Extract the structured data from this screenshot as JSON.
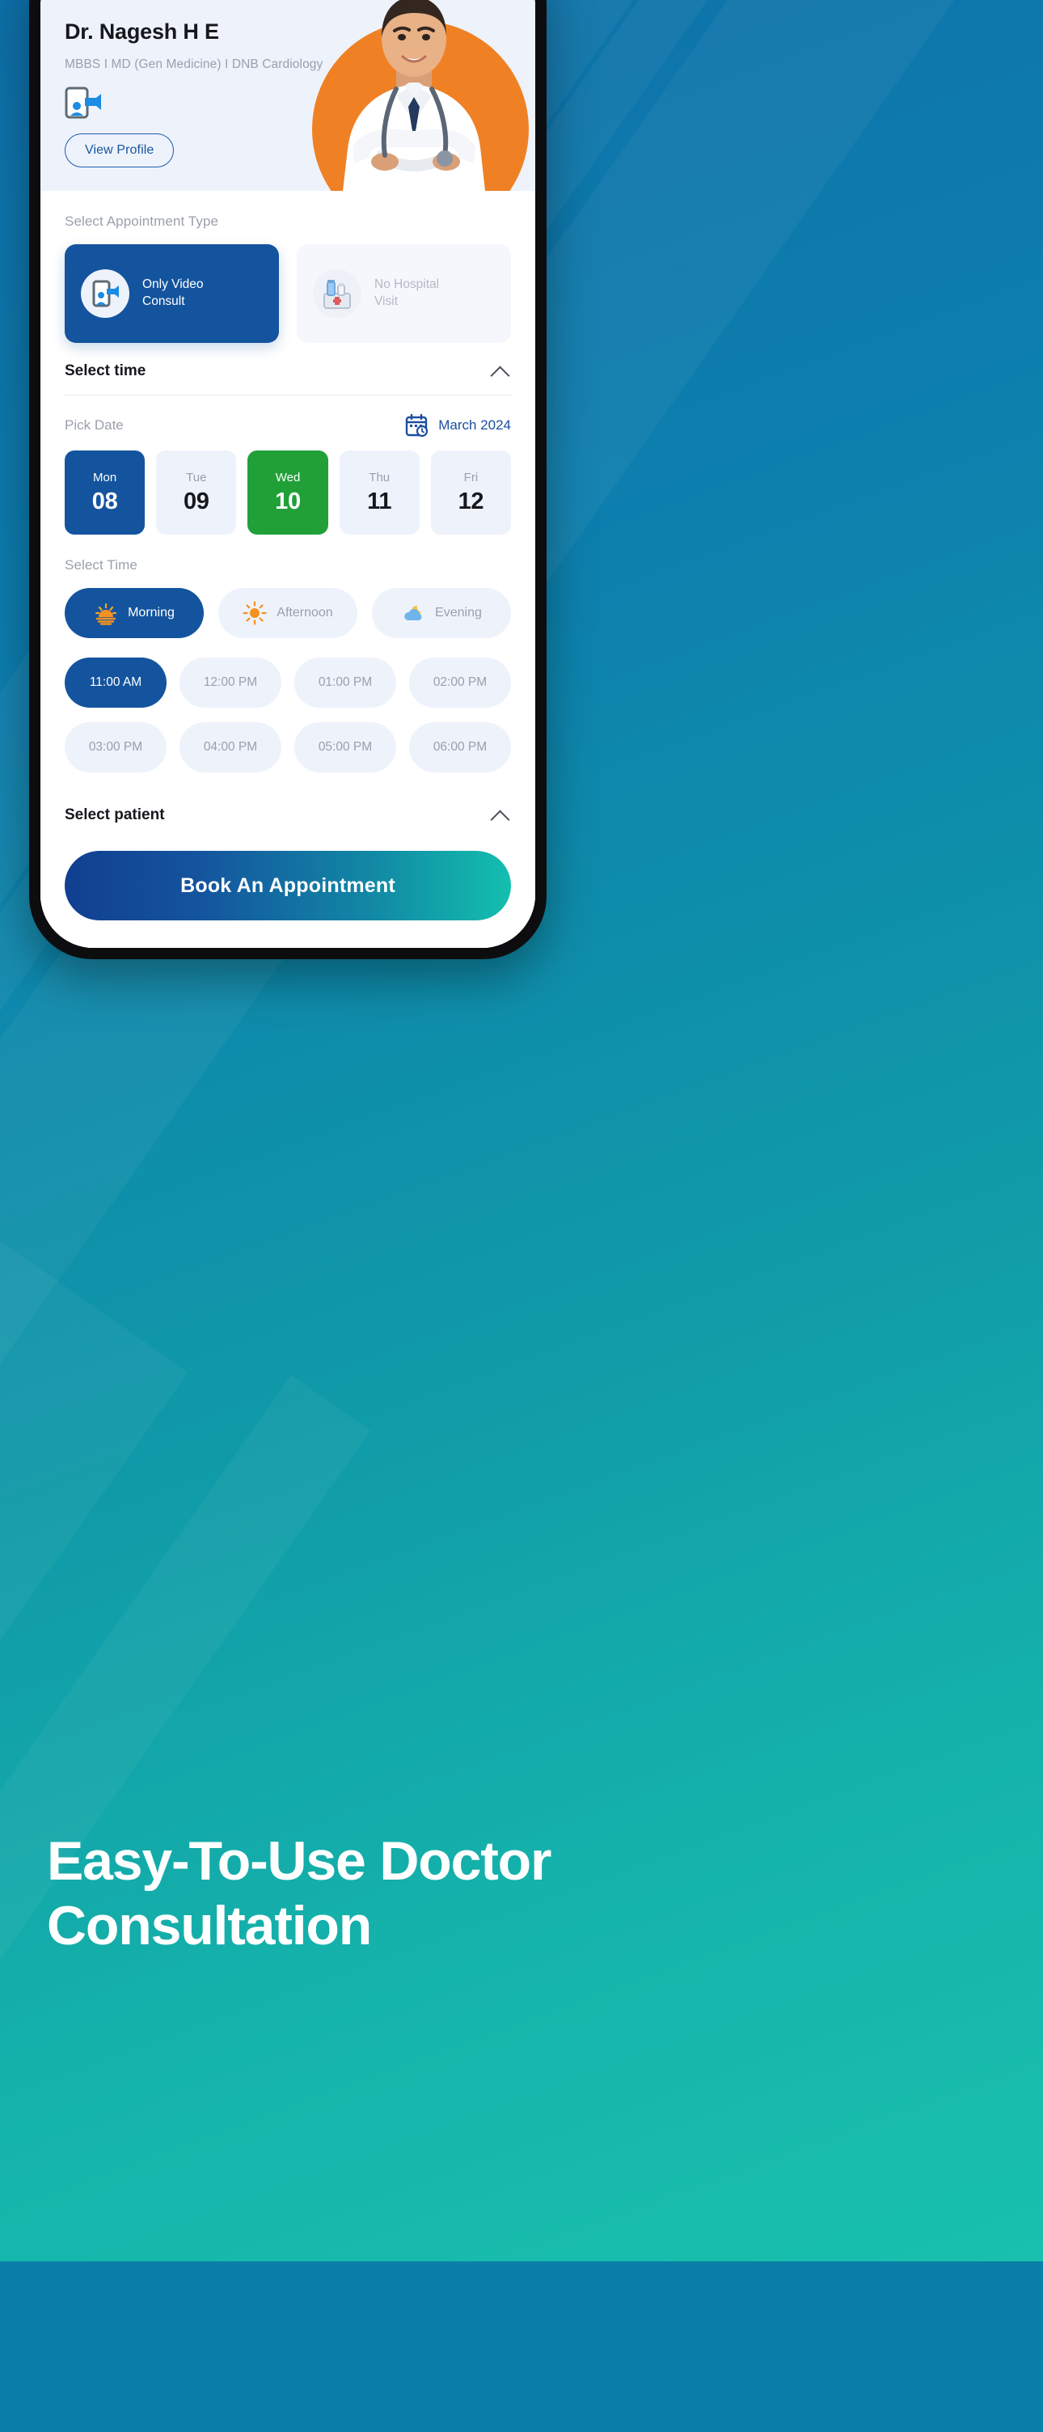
{
  "doctor": {
    "name": "Dr. Nagesh H E",
    "qualifications": "MBBS I MD (Gen Medicine) I DNB  Cardiology",
    "video_badge_icon": "video-consult-icon",
    "view_profile_label": "View Profile",
    "photo_alt": "doctor-portrait",
    "arc_color": "#ef8124"
  },
  "appointment_type": {
    "label": "Select Appointment Type",
    "options": [
      {
        "title": "Only Video\nConsult",
        "icon": "video-consult-icon",
        "selected": true
      },
      {
        "title": "No Hospital\nVisit",
        "icon": "medical-kit-icon",
        "selected": false
      }
    ]
  },
  "select_time_section": {
    "title": "Select time",
    "collapse_icon": "chevron-up-icon",
    "pick_date_label": "Pick Date",
    "calendar_icon": "calendar-icon",
    "month": "March 2024",
    "dates": [
      {
        "dow": "Mon",
        "num": "08",
        "state": "selected-blue"
      },
      {
        "dow": "Tue",
        "num": "09",
        "state": "default"
      },
      {
        "dow": "Wed",
        "num": "10",
        "state": "selected-green"
      },
      {
        "dow": "Thu",
        "num": "11",
        "state": "default"
      },
      {
        "dow": "Fri",
        "num": "12",
        "state": "default"
      }
    ],
    "select_time_label": "Select Time",
    "day_parts": [
      {
        "label": "Morning",
        "icon": "sunrise-icon",
        "selected": true
      },
      {
        "label": "Afternoon",
        "icon": "sun-icon",
        "selected": false
      },
      {
        "label": "Evening",
        "icon": "cloud-moon-icon",
        "selected": false
      }
    ],
    "slots": [
      {
        "label": "11:00 AM",
        "selected": true
      },
      {
        "label": "12:00 PM",
        "selected": false
      },
      {
        "label": "01:00 PM",
        "selected": false
      },
      {
        "label": "02:00 PM",
        "selected": false
      },
      {
        "label": "03:00 PM",
        "selected": false
      },
      {
        "label": "04:00 PM",
        "selected": false
      },
      {
        "label": "05:00 PM",
        "selected": false
      },
      {
        "label": "06:00 PM",
        "selected": false
      }
    ]
  },
  "select_patient_section": {
    "title": "Select patient",
    "collapse_icon": "chevron-up-icon",
    "avatars": [
      "patient-avatar-1",
      "patient-avatar-2",
      "patient-avatar-3"
    ]
  },
  "cta": {
    "label": "Book An Appointment"
  },
  "headline": {
    "text": "Easy-To-Use Doctor\nConsultation"
  },
  "colors": {
    "primary_blue": "#14549e",
    "accent_green": "#21a038",
    "accent_orange": "#ef8124",
    "bg_teal": "#13bfae",
    "surface": "#eef2fb"
  }
}
